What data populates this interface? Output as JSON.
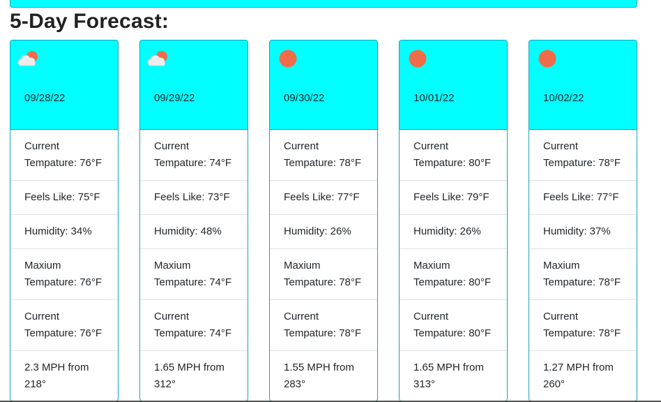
{
  "heading": "5-Day Forecast:",
  "colors": {
    "card_header": "#00ffff",
    "border": "#17a2b8",
    "sun": "#ef6c48",
    "cloud": "#e8e8e8"
  },
  "days": [
    {
      "icon": "partly-cloudy-icon",
      "date": "09/28/22",
      "current_label": "Current",
      "current_temp": "Tempature: 76°F",
      "feels": "Feels Like: 75°F",
      "humidity": "Humidity: 34%",
      "max_label": "Maxium",
      "max_temp": "Tempature: 76°F",
      "current2_label": "Current",
      "current2_temp": "Tempature: 76°F",
      "wind_speed": "2.3 MPH from",
      "wind_dir": "218°"
    },
    {
      "icon": "partly-cloudy-icon",
      "date": "09/29/22",
      "current_label": "Current",
      "current_temp": "Tempature: 74°F",
      "feels": "Feels Like: 73°F",
      "humidity": "Humidity: 48%",
      "max_label": "Maxium",
      "max_temp": "Tempature: 74°F",
      "current2_label": "Current",
      "current2_temp": "Tempature: 74°F",
      "wind_speed": "1.65 MPH from",
      "wind_dir": "312°"
    },
    {
      "icon": "sun-icon",
      "date": "09/30/22",
      "current_label": "Current",
      "current_temp": "Tempature: 78°F",
      "feels": "Feels Like: 77°F",
      "humidity": "Humidity: 26%",
      "max_label": "Maxium",
      "max_temp": "Tempature: 78°F",
      "current2_label": "Current",
      "current2_temp": "Tempature: 78°F",
      "wind_speed": "1.55 MPH from",
      "wind_dir": "283°"
    },
    {
      "icon": "sun-icon",
      "date": "10/01/22",
      "current_label": "Current",
      "current_temp": "Tempature: 80°F",
      "feels": "Feels Like: 79°F",
      "humidity": "Humidity: 26%",
      "max_label": "Maxium",
      "max_temp": "Tempature: 80°F",
      "current2_label": "Current",
      "current2_temp": "Tempature: 80°F",
      "wind_speed": "1.65 MPH from",
      "wind_dir": "313°"
    },
    {
      "icon": "sun-icon",
      "date": "10/02/22",
      "current_label": "Current",
      "current_temp": "Tempature: 78°F",
      "feels": "Feels Like: 77°F",
      "humidity": "Humidity: 37%",
      "max_label": "Maxium",
      "max_temp": "Tempature: 78°F",
      "current2_label": "Current",
      "current2_temp": "Tempature: 78°F",
      "wind_speed": "1.27 MPH from",
      "wind_dir": "260°"
    }
  ]
}
